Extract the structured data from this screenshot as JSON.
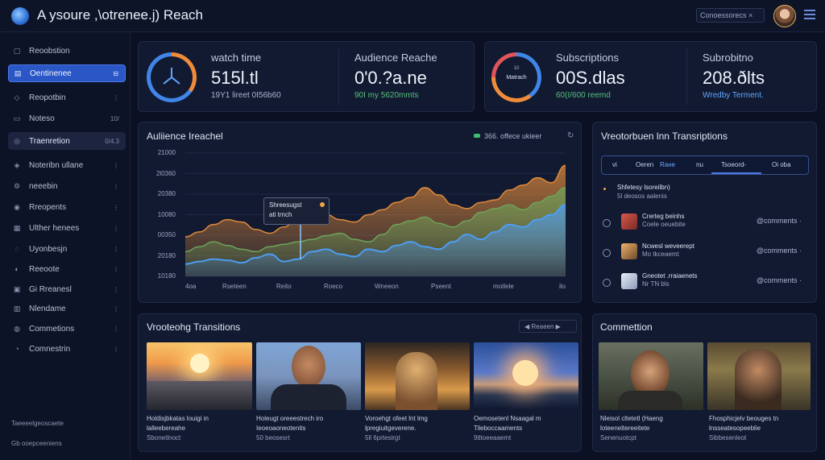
{
  "app": {
    "title": "A ysoure ,\\otreneе.j) Reach"
  },
  "topbar": {
    "search_text": "Conoessorecs ×"
  },
  "sidebar": {
    "items": [
      {
        "label": "Reoobstion",
        "badge": ""
      },
      {
        "label": "Oentinenee",
        "badge": ""
      },
      {
        "label": "Reopotbin",
        "badge": ""
      },
      {
        "label": "Notesо",
        "badge": "10/"
      },
      {
        "label": "Traenretion",
        "badge": "0/4.3"
      },
      {
        "label": "Noteribn ullane",
        "badge": ""
      },
      {
        "label": "neeebin",
        "badge": ""
      },
      {
        "label": "Rreopents",
        "badge": ""
      },
      {
        "label": "Ulther henees",
        "badge": ""
      },
      {
        "label": "Uyonbesjn",
        "badge": ""
      },
      {
        "label": "Reeoote",
        "badge": ""
      },
      {
        "label": "Gi Rreanesl",
        "badge": ""
      },
      {
        "label": "Nlendame",
        "badge": ""
      },
      {
        "label": "Commetions",
        "badge": ""
      },
      {
        "label": "Comnestrin",
        "badge": ""
      }
    ],
    "footer_line1": "Taeeeelgeoscaete",
    "footer_line2": "Gb ooepceeniens"
  },
  "kpis": [
    {
      "label": "watch time",
      "value": "515l.tl",
      "sub": "19Y1 lireet 0I56b60",
      "sub_color": "#aab4cd"
    },
    {
      "label": "Audience Reache",
      "value": "0'0.?a.ne",
      "sub": "90I my 5620mmts",
      "sub_color": "#57c07a"
    },
    {
      "label": "Subscriptions",
      "value": "00S.dlas",
      "sub": "60(I/600 reemd",
      "sub_color": "#57c07a"
    },
    {
      "label": "Subrobitno",
      "value": "208.ðlts",
      "sub": "Wredby Terment.",
      "sub_color": "#5fa7ff"
    }
  ],
  "ring_center_label": "Matrach",
  "ring_top_label": "10",
  "audience_chart": {
    "title": "Auliience  Ireachel",
    "legend_text": "366. offece ukieer",
    "tooltip_title": "Shreesugst",
    "tooltip_sub": "ati trnch"
  },
  "chart_data": {
    "type": "area",
    "title": "Auliience  Ireachel",
    "yticks": [
      "21000",
      "2l0360",
      "20380",
      "10080",
      "00350",
      "20180",
      "10180"
    ],
    "xticks": [
      "4oa",
      "Rseteen",
      "Reito",
      "Roeco",
      "Wneeon",
      "Pseent",
      "motlele",
      "ilo"
    ],
    "series": [
      {
        "name": "",
        "color": "#e08a3a",
        "values": [
          0.32,
          0.36,
          0.42,
          0.46,
          0.44,
          0.38,
          0.35,
          0.4,
          0.48,
          0.52,
          0.5,
          0.46,
          0.44,
          0.5,
          0.54,
          0.6,
          0.64,
          0.72,
          0.66,
          0.58,
          0.55,
          0.6,
          0.62,
          0.7,
          0.74,
          0.8,
          0.76,
          0.9
        ]
      },
      {
        "name": "",
        "color": "#6fa35a",
        "values": [
          0.2,
          0.24,
          0.28,
          0.25,
          0.22,
          0.2,
          0.24,
          0.26,
          0.28,
          0.3,
          0.33,
          0.35,
          0.3,
          0.28,
          0.34,
          0.42,
          0.45,
          0.48,
          0.43,
          0.4,
          0.45,
          0.52,
          0.55,
          0.58,
          0.54,
          0.6,
          0.65,
          0.72
        ]
      },
      {
        "name": "",
        "color": "#4d9df2",
        "values": [
          0.1,
          0.12,
          0.14,
          0.13,
          0.11,
          0.15,
          0.18,
          0.12,
          0.14,
          0.2,
          0.22,
          0.18,
          0.16,
          0.22,
          0.2,
          0.25,
          0.28,
          0.24,
          0.22,
          0.28,
          0.34,
          0.3,
          0.36,
          0.42,
          0.4,
          0.46,
          0.5,
          0.58
        ]
      }
    ]
  },
  "transitions": {
    "title": "Vreotorbuen lnn Transriptions",
    "tabs": [
      "vi",
      "Oeren",
      "Raнe",
      "nu",
      "Tsoeord-",
      "Oi  oba"
    ],
    "header_title": "Shfetesy lsoreilbn)",
    "header_sub": "5l deosos aalenis",
    "rows": [
      {
        "title": "Crerteg beinhs",
        "sub": "Coele oeuebite",
        "comments": "@comments ·"
      },
      {
        "title": "Ncwesl weveerept",
        "sub": "Mo  tkceaemt",
        "comments": "@comments ·"
      },
      {
        "title": "Gneotet .rraiaenets",
        "sub": "Nr TN bls",
        "comments": "@comments ·"
      }
    ]
  },
  "trending": {
    "title": "Vrooteohg Transitions",
    "control_label": "Reaeen ",
    "tiles": [
      {
        "line1": "Holdisjbkatas louigi in",
        "line2": "lalleebereahe",
        "line3": "Sbonetlnoct"
      },
      {
        "line1": "Holeugt oreeestrech iro",
        "line2": "Ieoeoaoneotenits",
        "line3": "50 beosesrt"
      },
      {
        "line1": "Voroehgt ofeet lnt lmg",
        "line2": "lpregiuitgeverene.",
        "line3": "5ll 6prtesirgt"
      },
      {
        "line1": "Oemosetenl Nsaagal m",
        "line2": "Tileboccaaments",
        "line3": "9tltoeeaaemt"
      }
    ]
  },
  "connection": {
    "title": "Commettion",
    "tiles": [
      {
        "line1": "Nleisol cltetetl (Haeng",
        "line2": "loteeneltereeitete",
        "line3": "Senenuotcpt"
      },
      {
        "line1": "Fhosphicjelv beouges tn",
        "line2": "lnsseatesopeeblie",
        "line3": "Sibbesenleot"
      }
    ]
  }
}
